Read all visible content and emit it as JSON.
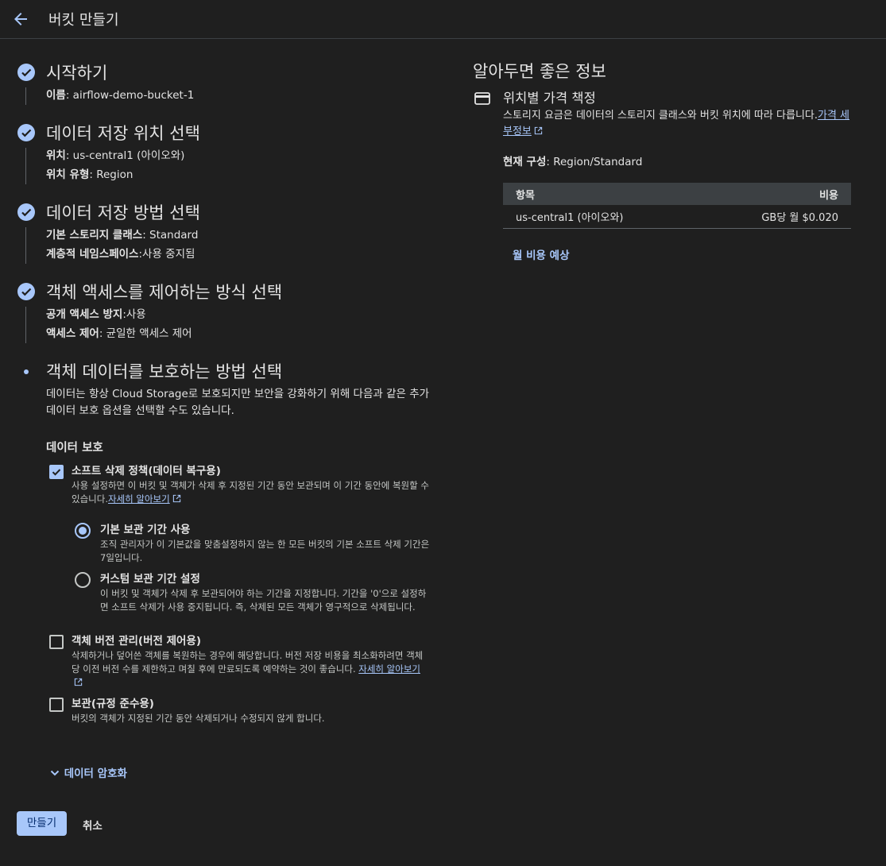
{
  "header": {
    "title": "버킷 만들기"
  },
  "steps": [
    {
      "title": "시작하기",
      "fields": [
        {
          "label": "이름",
          "value": ": airflow-demo-bucket-1"
        }
      ]
    },
    {
      "title": "데이터 저장 위치 선택",
      "fields": [
        {
          "label": "위치",
          "value": ": us-central1 (아이오와)"
        },
        {
          "label": "위치 유형",
          "value": ": Region"
        }
      ]
    },
    {
      "title": "데이터 저장 방법 선택",
      "fields": [
        {
          "label": "기본 스토리지 클래스",
          "value": ": Standard"
        },
        {
          "label": "계층적 네임스페이스",
          "value": ":사용 중지됨"
        }
      ]
    },
    {
      "title": "객체 액세스를 제어하는 방식 선택",
      "fields": [
        {
          "label": "공개 액세스 방지",
          "value": ":사용"
        },
        {
          "label": "액세스 제어",
          "value": ": 균일한 액세스 제어"
        }
      ]
    }
  ],
  "current_step": {
    "title": "객체 데이터를 보호하는 방법 선택",
    "description": "데이터는 항상 Cloud Storage로 보호되지만 보안을 강화하기 위해 다음과 같은 추가 데이터 보호 옵션을 선택할 수도 있습니다.",
    "section_title": "데이터 보호",
    "soft_delete": {
      "checked": true,
      "title": "소프트 삭제 정책(데이터 복구용)",
      "description": "사용 설정하면 이 버킷 및 객체가 삭제 후 지정된 기간 동안 보관되며 이 기간 동안에 복원할 수 있습니다.",
      "link": "자세히 알아보기",
      "default_option": {
        "selected": true,
        "title": "기본 보관 기간 사용",
        "description": "조직 관리자가 이 기본값을 맞춤설정하지 않는 한 모든 버킷의 기본 소프트 삭제 기간은 7일입니다."
      },
      "custom_option": {
        "selected": false,
        "title": "커스텀 보관 기간 설정",
        "description": "이 버킷 및 객체가 삭제 후 보관되어야 하는 기간을 지정합니다. 기간을 '0'으로 설정하면 소프트 삭제가 사용 중지됩니다. 즉, 삭제된 모든 객체가 영구적으로 삭제됩니다."
      }
    },
    "versioning": {
      "checked": false,
      "title": "객체 버전 관리(버전 제어용)",
      "description": "삭제하거나 덮어쓴 객체를 복원하는 경우에 해당합니다. 버전 저장 비용을 최소화하려면 객체당 이전 버전 수를 제한하고 며칠 후에 만료되도록 예약하는 것이 좋습니다.",
      "link": "자세히 알아보기"
    },
    "retention": {
      "checked": false,
      "title": "보관(규정 준수용)",
      "description": "버킷의 객체가 지정된 기간 동안 삭제되거나 수정되지 않게 합니다."
    },
    "expand_label": "데이터 암호화"
  },
  "actions": {
    "create": "만들기",
    "cancel": "취소"
  },
  "info_panel": {
    "title": "알아두면 좋은 정보",
    "pricing_title": "위치별 가격 책정",
    "pricing_desc": "스토리지 요금은 데이터의 스토리지 클래스와 버킷 위치에 따라 다릅니다.",
    "pricing_link": "가격 세부정보",
    "current_config_label": "현재 구성",
    "current_config_value": ": Region/Standard",
    "table": {
      "headers": [
        "항목",
        "비용"
      ],
      "rows": [
        {
          "item": "us-central1 (아이오와)",
          "cost": "GB당 월 $0.020"
        }
      ]
    },
    "monthly_link": "월 비용 예상"
  }
}
